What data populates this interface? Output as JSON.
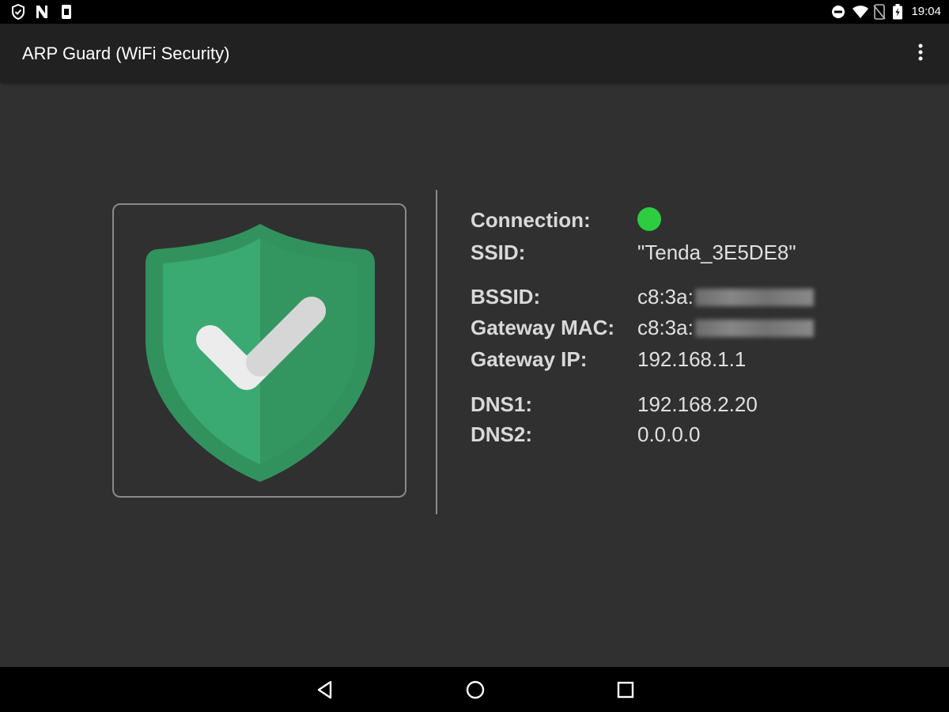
{
  "status_bar": {
    "time": "19:04",
    "left_icons": [
      "shield-icon",
      "n-notification-icon",
      "sim-icon"
    ],
    "right_icons": [
      "do-not-disturb-icon",
      "wifi-icon",
      "no-sim-icon",
      "battery-icon"
    ]
  },
  "app_bar": {
    "title": "ARP Guard (WiFi Security)",
    "menu_icon": "more-vert-icon"
  },
  "status_panel": {
    "icon": "shield-check-icon",
    "shield_colors": {
      "outer": "#31925E",
      "inner_left": "#3BAA72",
      "inner_right": "#33955F"
    }
  },
  "network_info": {
    "connection": {
      "label": "Connection:",
      "status_color": "#2ECC40"
    },
    "ssid": {
      "label": "SSID:",
      "value": "\"Tenda_3E5DE8\""
    },
    "bssid": {
      "label": "BSSID:",
      "value": "c8:3a:"
    },
    "gateway_mac": {
      "label": "Gateway MAC:",
      "value": "c8:3a:"
    },
    "gateway_ip": {
      "label": "Gateway IP:",
      "value": "192.168.1.1"
    },
    "dns1": {
      "label": "DNS1:",
      "value": "192.168.2.20"
    },
    "dns2": {
      "label": "DNS2:",
      "value": "0.0.0.0"
    }
  },
  "nav_bar": {
    "buttons": [
      "back-icon",
      "home-icon",
      "recents-icon"
    ]
  }
}
